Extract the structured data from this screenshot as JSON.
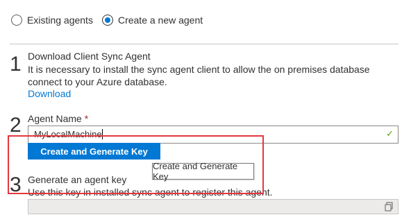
{
  "agent_choice": {
    "options": [
      "Existing agents",
      "Create a new agent"
    ],
    "selected": "Create a new agent"
  },
  "step1": {
    "number": "1",
    "title": "Download Client Sync Agent",
    "description": "It is necessary to install the sync agent client to allow the on premises database connect to your Azure database.",
    "link": "Download"
  },
  "step2": {
    "number": "2",
    "label": "Agent Name",
    "required_marker": "*",
    "value": "MyLocalMachine",
    "button_label": "Create and Generate Key",
    "tooltip": "Create and Generate Key"
  },
  "step3": {
    "number": "3",
    "title": "Generate an agent key",
    "description": "Use this key in installed sync agent to register this agent.",
    "key_value": ""
  },
  "colors": {
    "accent": "#0078d4",
    "highlight": "#e5363d",
    "valid": "#57a300"
  }
}
